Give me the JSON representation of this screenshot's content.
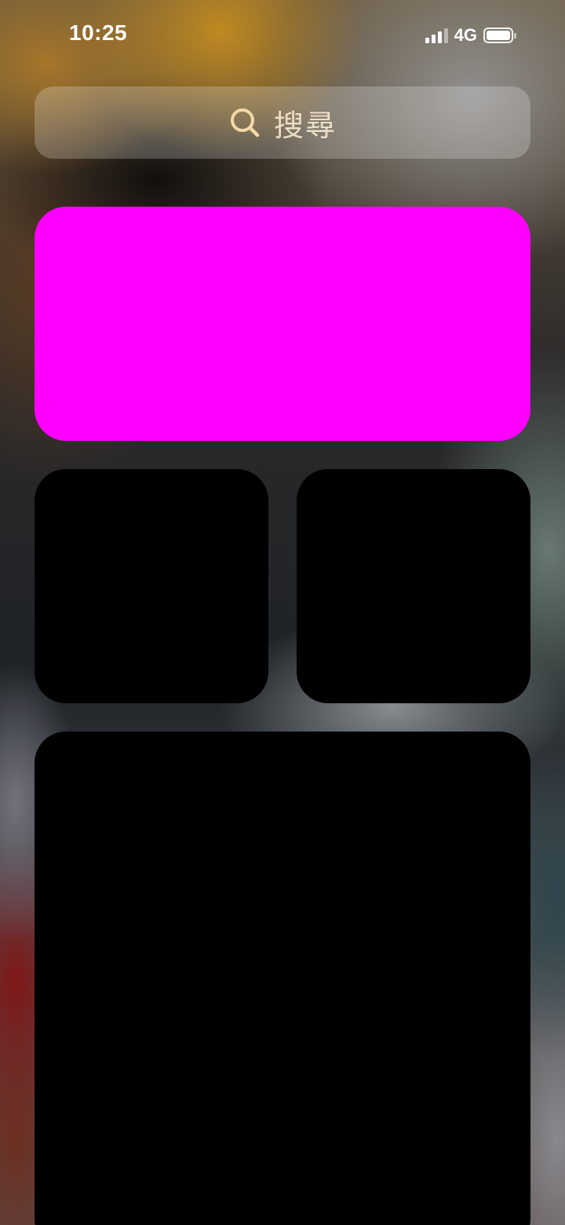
{
  "status_bar": {
    "time": "10:25",
    "network": "4G",
    "battery_level": 1.0,
    "signal_bars": 3,
    "signal_bars_total": 4
  },
  "search": {
    "placeholder": "搜尋",
    "icon": "search-icon"
  },
  "widgets": [
    {
      "id": "widget-large",
      "color": "#ff00ff"
    },
    {
      "id": "widget-small-left",
      "color": "#000000"
    },
    {
      "id": "widget-small-right",
      "color": "#000000"
    },
    {
      "id": "widget-xl",
      "color": "#000000"
    }
  ]
}
